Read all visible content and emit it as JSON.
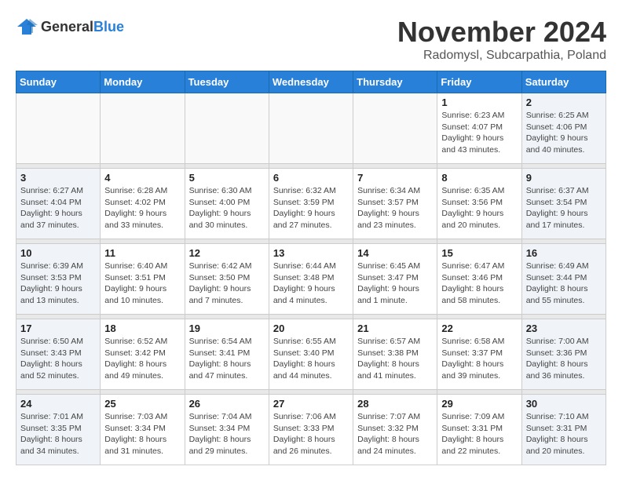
{
  "header": {
    "logo_general": "General",
    "logo_blue": "Blue",
    "title": "November 2024",
    "location": "Radomysl, Subcarpathia, Poland"
  },
  "weekdays": [
    "Sunday",
    "Monday",
    "Tuesday",
    "Wednesday",
    "Thursday",
    "Friday",
    "Saturday"
  ],
  "weeks": [
    [
      {
        "day": "",
        "info": ""
      },
      {
        "day": "",
        "info": ""
      },
      {
        "day": "",
        "info": ""
      },
      {
        "day": "",
        "info": ""
      },
      {
        "day": "",
        "info": ""
      },
      {
        "day": "1",
        "info": "Sunrise: 6:23 AM\nSunset: 4:07 PM\nDaylight: 9 hours\nand 43 minutes."
      },
      {
        "day": "2",
        "info": "Sunrise: 6:25 AM\nSunset: 4:06 PM\nDaylight: 9 hours\nand 40 minutes."
      }
    ],
    [
      {
        "day": "3",
        "info": "Sunrise: 6:27 AM\nSunset: 4:04 PM\nDaylight: 9 hours\nand 37 minutes."
      },
      {
        "day": "4",
        "info": "Sunrise: 6:28 AM\nSunset: 4:02 PM\nDaylight: 9 hours\nand 33 minutes."
      },
      {
        "day": "5",
        "info": "Sunrise: 6:30 AM\nSunset: 4:00 PM\nDaylight: 9 hours\nand 30 minutes."
      },
      {
        "day": "6",
        "info": "Sunrise: 6:32 AM\nSunset: 3:59 PM\nDaylight: 9 hours\nand 27 minutes."
      },
      {
        "day": "7",
        "info": "Sunrise: 6:34 AM\nSunset: 3:57 PM\nDaylight: 9 hours\nand 23 minutes."
      },
      {
        "day": "8",
        "info": "Sunrise: 6:35 AM\nSunset: 3:56 PM\nDaylight: 9 hours\nand 20 minutes."
      },
      {
        "day": "9",
        "info": "Sunrise: 6:37 AM\nSunset: 3:54 PM\nDaylight: 9 hours\nand 17 minutes."
      }
    ],
    [
      {
        "day": "10",
        "info": "Sunrise: 6:39 AM\nSunset: 3:53 PM\nDaylight: 9 hours\nand 13 minutes."
      },
      {
        "day": "11",
        "info": "Sunrise: 6:40 AM\nSunset: 3:51 PM\nDaylight: 9 hours\nand 10 minutes."
      },
      {
        "day": "12",
        "info": "Sunrise: 6:42 AM\nSunset: 3:50 PM\nDaylight: 9 hours\nand 7 minutes."
      },
      {
        "day": "13",
        "info": "Sunrise: 6:44 AM\nSunset: 3:48 PM\nDaylight: 9 hours\nand 4 minutes."
      },
      {
        "day": "14",
        "info": "Sunrise: 6:45 AM\nSunset: 3:47 PM\nDaylight: 9 hours\nand 1 minute."
      },
      {
        "day": "15",
        "info": "Sunrise: 6:47 AM\nSunset: 3:46 PM\nDaylight: 8 hours\nand 58 minutes."
      },
      {
        "day": "16",
        "info": "Sunrise: 6:49 AM\nSunset: 3:44 PM\nDaylight: 8 hours\nand 55 minutes."
      }
    ],
    [
      {
        "day": "17",
        "info": "Sunrise: 6:50 AM\nSunset: 3:43 PM\nDaylight: 8 hours\nand 52 minutes."
      },
      {
        "day": "18",
        "info": "Sunrise: 6:52 AM\nSunset: 3:42 PM\nDaylight: 8 hours\nand 49 minutes."
      },
      {
        "day": "19",
        "info": "Sunrise: 6:54 AM\nSunset: 3:41 PM\nDaylight: 8 hours\nand 47 minutes."
      },
      {
        "day": "20",
        "info": "Sunrise: 6:55 AM\nSunset: 3:40 PM\nDaylight: 8 hours\nand 44 minutes."
      },
      {
        "day": "21",
        "info": "Sunrise: 6:57 AM\nSunset: 3:38 PM\nDaylight: 8 hours\nand 41 minutes."
      },
      {
        "day": "22",
        "info": "Sunrise: 6:58 AM\nSunset: 3:37 PM\nDaylight: 8 hours\nand 39 minutes."
      },
      {
        "day": "23",
        "info": "Sunrise: 7:00 AM\nSunset: 3:36 PM\nDaylight: 8 hours\nand 36 minutes."
      }
    ],
    [
      {
        "day": "24",
        "info": "Sunrise: 7:01 AM\nSunset: 3:35 PM\nDaylight: 8 hours\nand 34 minutes."
      },
      {
        "day": "25",
        "info": "Sunrise: 7:03 AM\nSunset: 3:34 PM\nDaylight: 8 hours\nand 31 minutes."
      },
      {
        "day": "26",
        "info": "Sunrise: 7:04 AM\nSunset: 3:34 PM\nDaylight: 8 hours\nand 29 minutes."
      },
      {
        "day": "27",
        "info": "Sunrise: 7:06 AM\nSunset: 3:33 PM\nDaylight: 8 hours\nand 26 minutes."
      },
      {
        "day": "28",
        "info": "Sunrise: 7:07 AM\nSunset: 3:32 PM\nDaylight: 8 hours\nand 24 minutes."
      },
      {
        "day": "29",
        "info": "Sunrise: 7:09 AM\nSunset: 3:31 PM\nDaylight: 8 hours\nand 22 minutes."
      },
      {
        "day": "30",
        "info": "Sunrise: 7:10 AM\nSunset: 3:31 PM\nDaylight: 8 hours\nand 20 minutes."
      }
    ]
  ]
}
